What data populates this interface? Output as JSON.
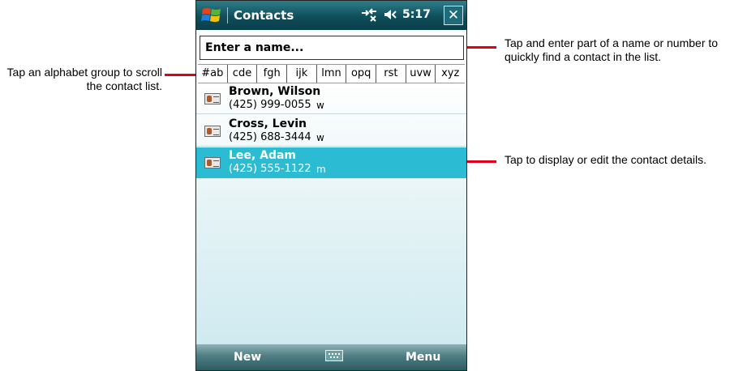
{
  "callouts": {
    "search": "Tap and enter part of a name or number to quickly find a contact in the list.",
    "alphabet": "Tap an alphabet group to scroll the contact list.",
    "contact": "Tap to display or edit the contact details."
  },
  "titlebar": {
    "title": "Contacts",
    "time": "5:17",
    "close_label": "✕"
  },
  "search": {
    "placeholder": "Enter a name..."
  },
  "alphabet_groups": [
    "#ab",
    "cde",
    "fgh",
    "ijk",
    "lmn",
    "opq",
    "rst",
    "uvw",
    "xyz"
  ],
  "contacts": [
    {
      "name": "Brown, Wilson",
      "phone": "(425) 999-0055",
      "type": "w",
      "selected": false
    },
    {
      "name": "Cross, Levin",
      "phone": "(425) 688-3444",
      "type": "w",
      "selected": false
    },
    {
      "name": "Lee, Adam",
      "phone": "(425) 555-1122",
      "type": "m",
      "selected": true
    }
  ],
  "menubar": {
    "left_softkey": "New",
    "right_softkey": "Menu",
    "center_icon": "keyboard-icon"
  },
  "colors": {
    "titlebar": "#0e4e5a",
    "selected_row": "#2bbbd3",
    "leader_line": "#e0001b"
  }
}
